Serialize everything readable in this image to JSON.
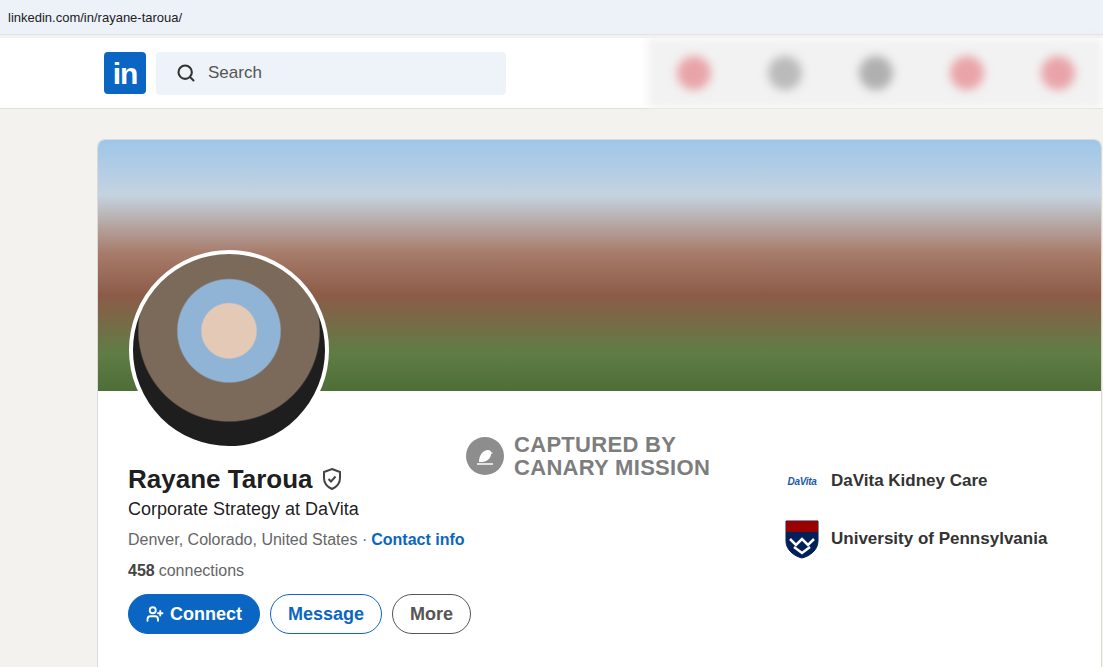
{
  "browser": {
    "url": "linkedin.com/in/rayane-taroua/"
  },
  "header": {
    "logo": "in",
    "search": {
      "placeholder": "Search"
    },
    "nav_items": [
      {
        "color": "#e58a90"
      },
      {
        "color": "#a8a8a8"
      },
      {
        "color": "#9a9a9a"
      },
      {
        "color": "#e58a90"
      },
      {
        "color": "#e58a90"
      }
    ]
  },
  "profile": {
    "name": "Rayane Taroua",
    "verified": true,
    "headline": "Corporate Strategy at DaVita",
    "location": "Denver, Colorado, United States",
    "separator": "·",
    "contact_link": "Contact info",
    "connections_count": "458",
    "connections_label": "connections"
  },
  "actions": [
    {
      "label": "Connect",
      "kind": "primary"
    },
    {
      "label": "Message",
      "kind": "outline"
    },
    {
      "label": "More",
      "kind": "muted"
    }
  ],
  "organizations": [
    {
      "name": "DaVita Kidney Care",
      "kind": "davita",
      "logo_text": "DaVita"
    },
    {
      "name": "University of Pennsylvania",
      "kind": "penn",
      "logo_text": ""
    }
  ],
  "watermark": {
    "lines": [
      "CAPTURED BY",
      "CANARY MISSION"
    ]
  }
}
